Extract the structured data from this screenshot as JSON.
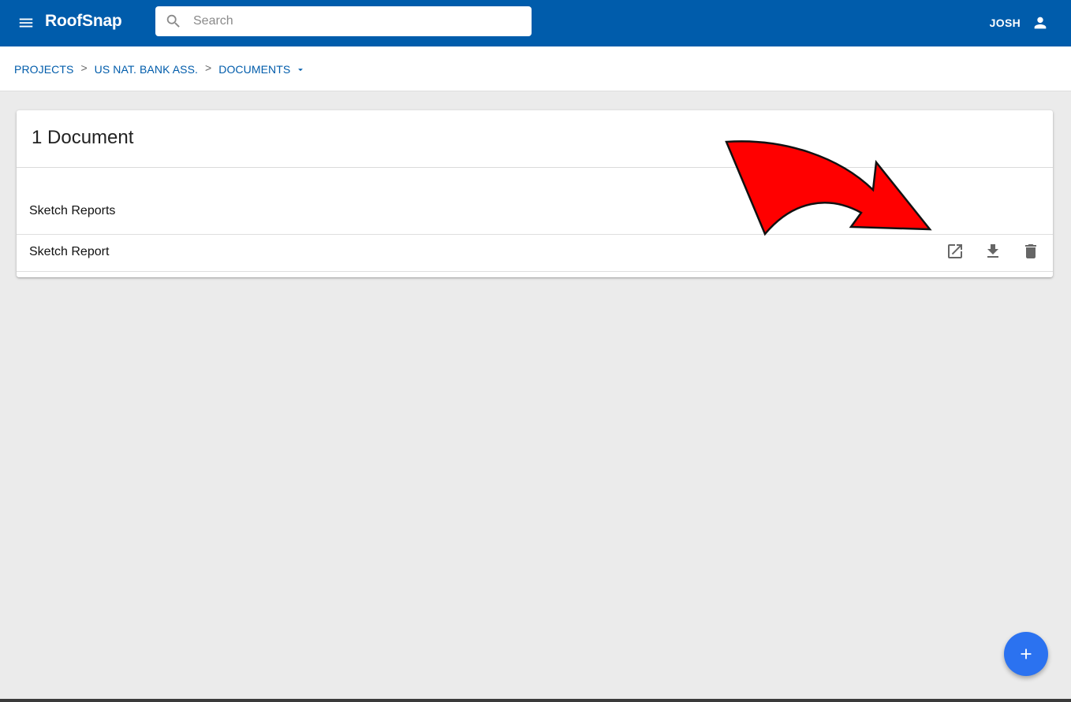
{
  "app": {
    "brand": "RoofSnap",
    "menu_icon": "menu-icon",
    "colors": {
      "appbar": "#005cab",
      "fab": "#2b72f0",
      "annotation_arrow": "#ff0000"
    }
  },
  "search": {
    "placeholder": "Search",
    "value": "",
    "icon": "search-icon"
  },
  "user": {
    "name": "JOSH",
    "icon": "account-icon"
  },
  "breadcrumb": {
    "items": [
      "PROJECTS",
      "US NAT. BANK ASS.",
      "DOCUMENTS"
    ],
    "separator": ">",
    "dropdown_icon": "caret-down-icon"
  },
  "documents": {
    "title": "1 Document",
    "section": "Sketch Reports",
    "rows": [
      {
        "name": "Sketch Report",
        "actions": [
          "open-in-new-icon",
          "download-icon",
          "delete-icon"
        ]
      }
    ]
  },
  "fab": {
    "label": "+",
    "icon": "add-icon"
  }
}
